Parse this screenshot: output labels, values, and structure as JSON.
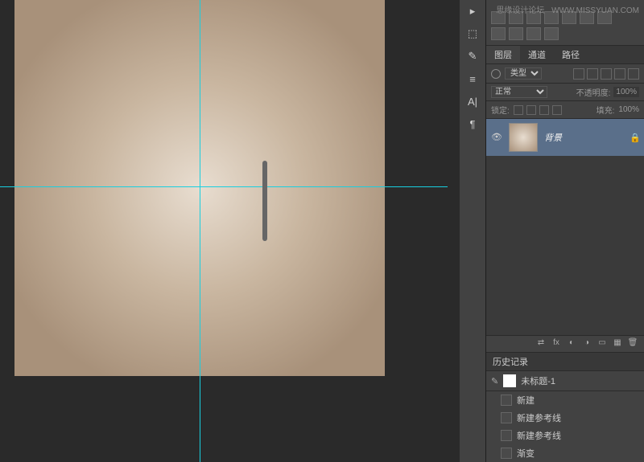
{
  "watermark": {
    "text": "思缘设计论坛",
    "url": "WWW.MISSYUAN.COM"
  },
  "panels": {
    "tabs": {
      "layers": "图层",
      "channels": "通道",
      "paths": "路径"
    },
    "filter": {
      "kind": "类型"
    },
    "blend": {
      "mode": "正常",
      "opacityLabel": "不透明度:",
      "opacityValue": "100%"
    },
    "lock": {
      "label": "锁定:",
      "fillLabel": "填充:",
      "fillValue": "100%"
    },
    "layer": {
      "name": "背景"
    },
    "history": {
      "title": "历史记录",
      "document": "未标题-1",
      "items": [
        "新建",
        "新建参考线",
        "新建参考线",
        "渐变"
      ]
    }
  }
}
